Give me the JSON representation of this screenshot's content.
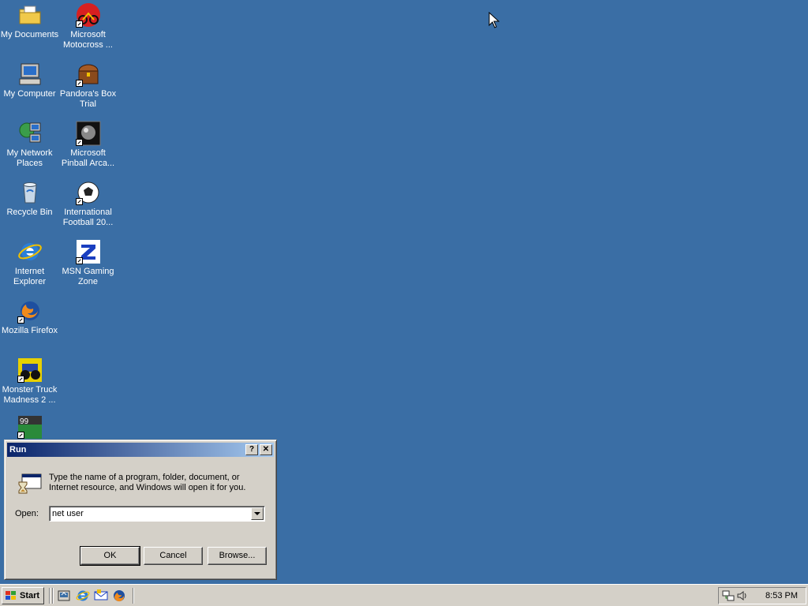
{
  "desktop": {
    "icons": [
      {
        "label": "My Documents",
        "icon": "folder-documents-icon"
      },
      {
        "label": "Microsoft Motocross ...",
        "icon": "motocross-icon"
      },
      {
        "label": "My Computer",
        "icon": "computer-icon"
      },
      {
        "label": "Pandora's Box Trial",
        "icon": "treasure-box-icon"
      },
      {
        "label": "My Network Places",
        "icon": "network-icon"
      },
      {
        "label": "Microsoft Pinball Arca...",
        "icon": "pinball-icon"
      },
      {
        "label": "Recycle Bin",
        "icon": "recycle-bin-icon"
      },
      {
        "label": "International Football 20...",
        "icon": "football-icon"
      },
      {
        "label": "Internet Explorer",
        "icon": "ie-icon"
      },
      {
        "label": "MSN Gaming Zone",
        "icon": "msn-zone-icon"
      },
      {
        "label": "Mozilla Firefox",
        "icon": "firefox-icon"
      },
      {
        "label": "Monster Truck Madness 2 ...",
        "icon": "monster-truck-icon"
      }
    ]
  },
  "run_dialog": {
    "title": "Run",
    "help_button": "?",
    "close_button": "✕",
    "description": "Type the name of a program, folder, document, or Internet resource, and Windows will open it for you.",
    "open_label": "Open:",
    "open_value": "net user",
    "ok_label": "OK",
    "cancel_label": "Cancel",
    "browse_label": "Browse..."
  },
  "taskbar": {
    "start_label": "Start",
    "quick_launch": [
      "show-desktop-icon",
      "ie-icon",
      "outlook-icon",
      "firefox-icon"
    ],
    "tray_icons": [
      "network-tray-icon",
      "volume-icon"
    ],
    "clock": "8:53 PM"
  },
  "colors": {
    "desktop": "#3a6ea5",
    "title_start": "#0a246a",
    "title_end": "#a6caf0",
    "face": "#d4d0c8"
  }
}
